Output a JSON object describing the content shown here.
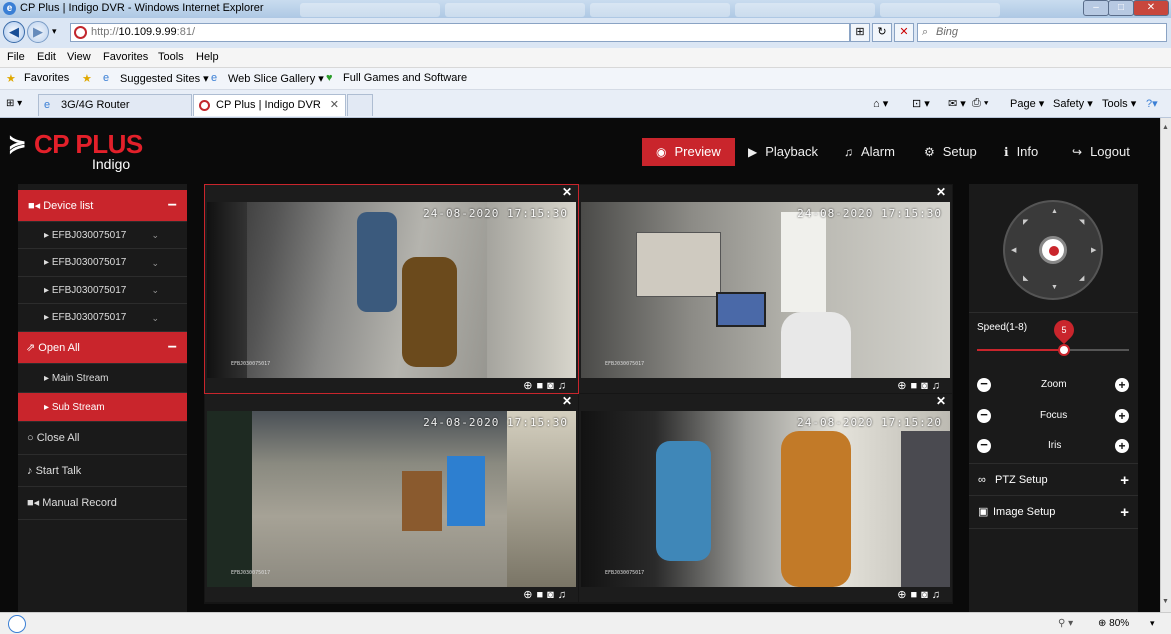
{
  "browser": {
    "window_title": "CP Plus | Indigo DVR - Windows Internet Explorer",
    "url_prefix": "http://",
    "url_host": "10.109.9.99",
    "url_rest": ":81/",
    "search_placeholder": "Bing",
    "menu": [
      "File",
      "Edit",
      "View",
      "Favorites",
      "Tools",
      "Help"
    ],
    "favorites_label": "Favorites",
    "fav_links": [
      "Suggested Sites ▾",
      "Web Slice Gallery ▾",
      "Full Games and Software"
    ],
    "tabs": [
      {
        "label": "3G/4G Router"
      },
      {
        "label": "CP Plus | Indigo DVR"
      }
    ],
    "commands": [
      "Page ▾",
      "Safety ▾",
      "Tools ▾"
    ],
    "zoom": "80%"
  },
  "dvr": {
    "brand": "CP PLUS",
    "brand_sub": "Indigo",
    "nav": [
      {
        "label": "Preview",
        "icon": "◉"
      },
      {
        "label": "Playback",
        "icon": "▶"
      },
      {
        "label": "Alarm",
        "icon": "♫"
      },
      {
        "label": "Setup",
        "icon": "⚙"
      },
      {
        "label": "Info",
        "icon": "ℹ"
      },
      {
        "label": "Logout",
        "icon": "↪"
      }
    ],
    "sidebar": {
      "device_list": "Device list",
      "devices": [
        "EFBJ030075017",
        "EFBJ030075017",
        "EFBJ030075017",
        "EFBJ030075017"
      ],
      "open_all": "Open All",
      "main_stream": "Main Stream",
      "sub_stream": "Sub Stream",
      "close_all": "Close All",
      "start_talk": "Start Talk",
      "manual_record": "Manual Record"
    },
    "videos": [
      {
        "timestamp": "24-08-2020 17:15:30",
        "cam_id": "EFBJ030075017"
      },
      {
        "timestamp": "24-08-2020 17:15:30",
        "cam_id": "EFBJ030075017"
      },
      {
        "timestamp": "24-08-2020 17:15:30",
        "cam_id": "EFBJ030075017"
      },
      {
        "timestamp": "24-08-2020 17:15:20",
        "cam_id": "EFBJ030075017"
      }
    ],
    "ptz": {
      "speed_label": "Speed(1-8)",
      "speed_value": "5",
      "speed_min": 1,
      "speed_max": 8,
      "zoom_label": "Zoom",
      "focus_label": "Focus",
      "iris_label": "Iris",
      "ptz_setup": "PTZ Setup",
      "image_setup": "Image Setup"
    }
  }
}
